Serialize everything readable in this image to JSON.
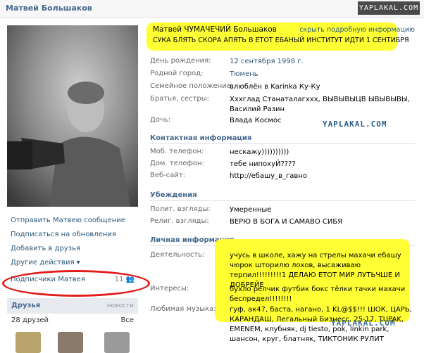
{
  "header": {
    "title": "Матвей Большаков"
  },
  "watermarks": {
    "top": "YAPLAKAL.COM",
    "mid": "YAPLAKAL.COM",
    "bottom": "YAPLAKAL.COM"
  },
  "left": {
    "actions": [
      "Отправить Матвею сообщение",
      "Подписаться на обновления",
      "Добавить в друзья",
      "Другие действия ▾"
    ],
    "subscribers": {
      "label": "Подписчики Матвея",
      "count": "11"
    },
    "friends": {
      "title": "Друзья",
      "news": "новости",
      "count": "28 друзей",
      "all": "Все"
    }
  },
  "profile": {
    "name": "Матвей ЧУМАЧЕЧИЙ Большаков",
    "hide_link": "скрыть подробную информацию",
    "status": "СУКА БЛЯТЬ СКОРА АПЯТЬ В ЕТОТ ЕБАНЫЙ ИНСТИТУТ ИДТИ 1 СЕНТИБРЯ",
    "basic": [
      {
        "label": "День рождения:",
        "value": "12 сентября 1998 г."
      },
      {
        "label": "Родной город:",
        "value": "Тюмень"
      },
      {
        "label": "Семейное положение:",
        "value": "влюблён в Karinka Ку-Ку"
      },
      {
        "label": "Братья, сестры:",
        "value": "Хххглад Станаталагххх, ВЫВЫВЫЦВ ЫВЫВЫВЫ, Василий Разин"
      },
      {
        "label": "Дочь:",
        "value": "Влада Космос"
      }
    ],
    "contact_title": "Контактная информация",
    "contact": [
      {
        "label": "Моб. телефон:",
        "value": "нескажу))))))))))"
      },
      {
        "label": "Дом. телефон:",
        "value": "тебе нипохуЙ????"
      },
      {
        "label": "Веб-сайт:",
        "value": "http://ебашу_в_гавно"
      }
    ],
    "beliefs_title": "Убеждения",
    "beliefs": [
      {
        "label": "Полит. взгляды:",
        "value": "Умеренные"
      },
      {
        "label": "Религ. взгляды:",
        "value": "ВЕРЮ В БОГА И САМАВО СИБЯ"
      }
    ],
    "personal_title": "Личная информация",
    "personal": [
      {
        "label": "Деятельность:",
        "value": "учусь в школе, хажу на стрелы махачи ебашу чюрок шторилю лохов, высаживаю терпил!!!!!!!!!1 ДЕЛАЮ ЕТОТ МИР ЛУТЬЧШЕ И ДОБРЕЙЕ"
      },
      {
        "label": "Интересы:",
        "value": "бухло релчик футбик бокс тёлки тачки махачи беспредел!!!!!!!!"
      },
      {
        "label": "Любимая музыка:",
        "value": "гуф, ак47, баста, нагано, 1 KL@$$!!! ШОК, ЦАРЬ, КАРАНДАШ, Легальный Бизнесс, 25-17, TUPAK, EMENEM, клубняк, dj tiesto, pok, linkin park, шансон, круг, блатняк, ТИКТОНИК РУЛИТ"
      }
    ]
  }
}
